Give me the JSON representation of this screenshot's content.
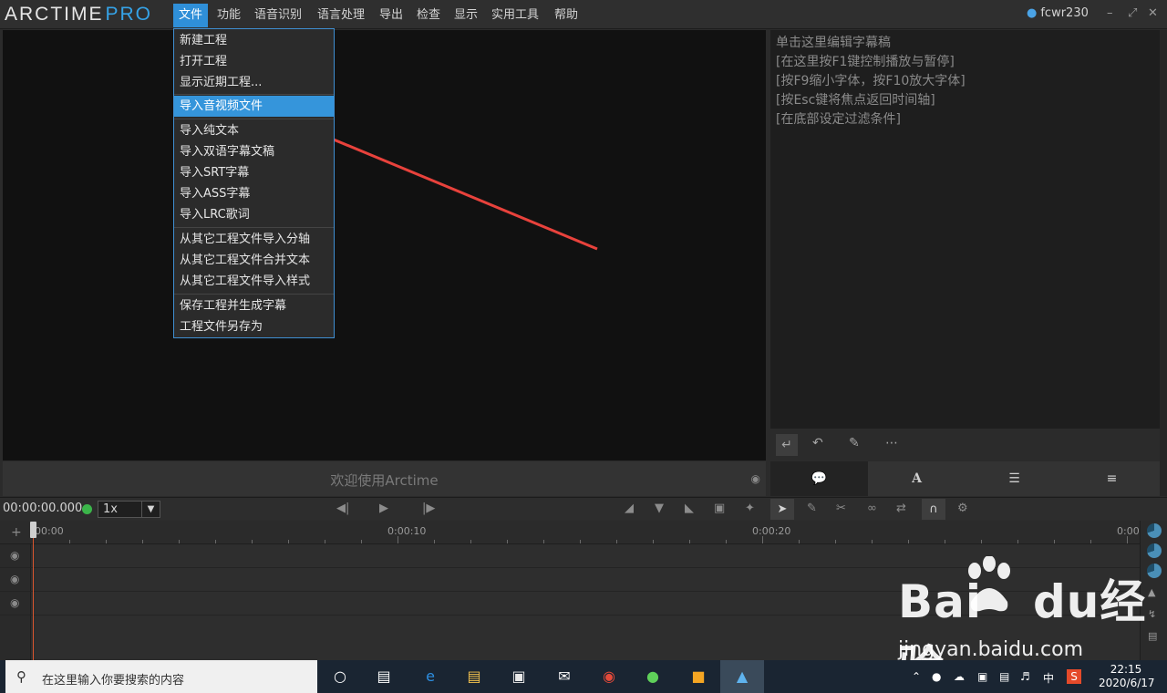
{
  "app": {
    "logo_main": "ARCTIME",
    "logo_pro": "PRO",
    "user": "fcwr230"
  },
  "menubar": {
    "items": [
      "文件",
      "功能",
      "语音识别",
      "语言处理",
      "导出",
      "检查",
      "显示",
      "实用工具",
      "帮助"
    ]
  },
  "file_menu": {
    "items": [
      "新建工程",
      "打开工程",
      "显示近期工程...",
      "导入音视频文件",
      "导入纯文本",
      "导入双语字幕文稿",
      "导入SRT字幕",
      "导入ASS字幕",
      "导入LRC歌词",
      "从其它工程文件导入分轴",
      "从其它工程文件合并文本",
      "从其它工程文件导入样式",
      "保存工程并生成字幕",
      "工程文件另存为"
    ],
    "highlighted": "导入音视频文件"
  },
  "video": {
    "welcome": "欢迎使用Arctime"
  },
  "subtitle_panel": {
    "lines": [
      "单击这里编辑字幕稿",
      "[在这里按F1键控制播放与暂停]",
      "[按F9缩小字体，按F10放大字体]",
      "[按Esc键将焦点返回时间轴]",
      "[在底部设定过滤条件]"
    ]
  },
  "transport": {
    "timecode": "00:00:00.000",
    "speed": "1x"
  },
  "timeline": {
    "ruler_labels": [
      "00:00",
      "0:00:10",
      "0:00:20",
      "0:00:"
    ]
  },
  "watermark": {
    "text_a": "Bai",
    "text_b": "du",
    "text_c": "经验",
    "url": "jingyan.baidu.com"
  },
  "taskbar": {
    "search_placeholder": "在这里输入你要搜索的内容",
    "ime": "中",
    "time": "22:15",
    "date": "2020/6/17"
  },
  "colors": {
    "accent": "#2f8fd8",
    "menu_highlight": "#3595db",
    "arrow": "#e8423c",
    "playhead": "#d9552e"
  }
}
